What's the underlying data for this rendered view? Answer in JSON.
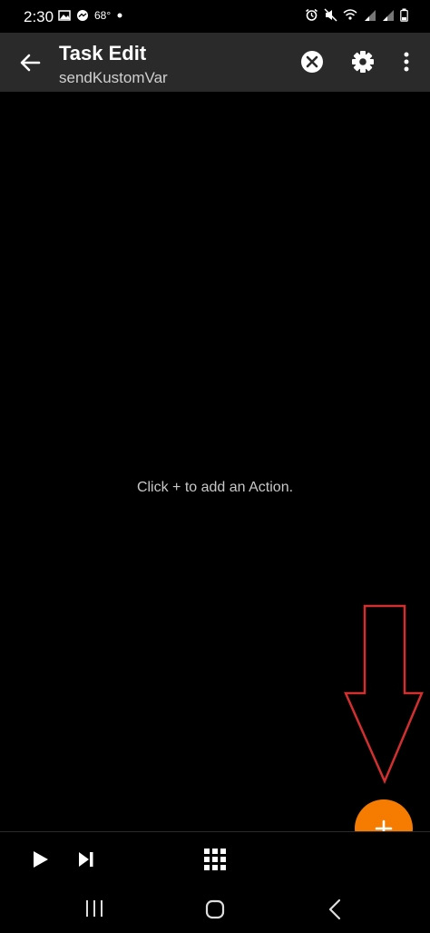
{
  "status_bar": {
    "time": "2:30",
    "temperature": "68°",
    "icons": [
      "gallery-icon",
      "messenger-icon",
      "dot-icon",
      "alarm-icon",
      "mute-icon",
      "wifi-call-icon",
      "signal-icon",
      "signal-icon",
      "battery-icon"
    ]
  },
  "app_bar": {
    "title": "Task Edit",
    "subtitle": "sendKustomVar",
    "icons": [
      "back-arrow-icon",
      "clear-icon",
      "settings-icon",
      "more-vert-icon"
    ]
  },
  "content": {
    "empty_hint": "Click + to add an Action."
  },
  "fab": {
    "icon": "plus-icon",
    "color": "#f57c00"
  },
  "annotation": {
    "type": "down-arrow",
    "color": "#d32f2f"
  },
  "bottom_toolbar": {
    "icons": [
      "play-icon",
      "skip-next-icon",
      "grid-icon"
    ]
  },
  "nav_bar": {
    "icons": [
      "recents-icon",
      "home-icon",
      "nav-back-icon"
    ]
  },
  "colors": {
    "background": "#000000",
    "app_bar": "#2a2a2a",
    "accent": "#f57c00"
  }
}
